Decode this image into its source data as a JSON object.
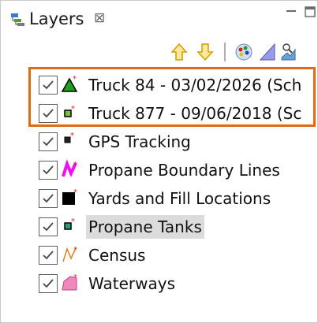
{
  "tab": {
    "title": "Layers",
    "close_glyph": "⊠"
  },
  "icons": {
    "tab": "layers-icon",
    "move_up": "arrow-up-icon",
    "move_down": "arrow-down-icon",
    "palette": "palette-icon",
    "style": "triangle-style-icon",
    "properties": "layer-properties-icon"
  },
  "colors": {
    "highlight": "#e06a10",
    "selection": "#dcdcdc"
  },
  "layers": [
    {
      "label": "Truck 84 - 03/02/2026 (Sch",
      "visible": true,
      "icon": "green-triangle-icon"
    },
    {
      "label": "Truck 877 - 09/06/2018 (Sc",
      "visible": true,
      "icon": "green-square-point-icon"
    },
    {
      "label": "GPS Tracking",
      "visible": true,
      "icon": "black-square-point-icon"
    },
    {
      "label": "Propane Boundary Lines",
      "visible": true,
      "icon": "magenta-line-icon"
    },
    {
      "label": "Yards and Fill Locations",
      "visible": true,
      "icon": "black-square-icon"
    },
    {
      "label": "Propane Tanks",
      "visible": true,
      "icon": "teal-square-point-icon",
      "selected": true
    },
    {
      "label": "Census",
      "visible": true,
      "icon": "orange-line-icon"
    },
    {
      "label": "Waterways",
      "visible": true,
      "icon": "pink-polygon-icon"
    }
  ]
}
